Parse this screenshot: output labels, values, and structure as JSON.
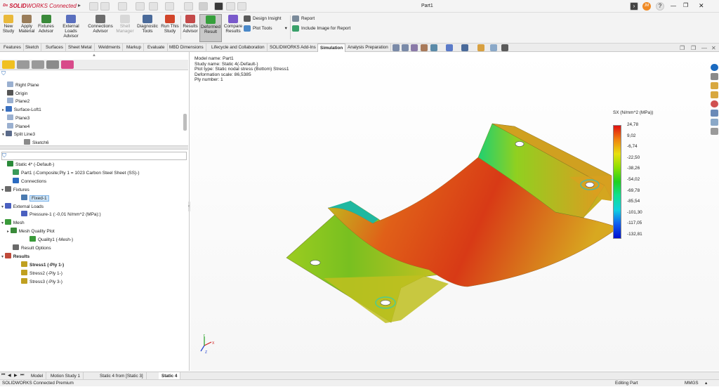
{
  "app": {
    "brand_solid": "SOLID",
    "brand_works": "WORKS",
    "brand_connected": " Connected",
    "doc_title": "Part1"
  },
  "ribbon": {
    "new_study": "New\nStudy",
    "apply_material": "Apply\nMaterial",
    "fixtures_advisor": "Fixtures\nAdvisor",
    "external_loads_advisor": "External Loads\nAdvisor",
    "connections_advisor": "Connections\nAdvisor",
    "shell_manager": "Shell\nManager",
    "diagnostic_tools": "Diagnostic\nTools",
    "run_this_study": "Run This\nStudy",
    "results_advisor": "Results\nAdvisor",
    "deformed_result": "Deformed\nResult",
    "compare_results": "Compare\nResults",
    "design_insight": "Design Insight",
    "plot_tools": "Plot Tools",
    "report": "Report",
    "include_image": "Include Image for Report"
  },
  "tabs": [
    "Features",
    "Sketch",
    "Surfaces",
    "Sheet Metal",
    "Weldments",
    "Markup",
    "Evaluate",
    "MBD Dimensions",
    "Lifecycle and Collaboration",
    "SOLIDWORKS Add-Ins",
    "Simulation",
    "Analysis Preparation"
  ],
  "active_tab": "Simulation",
  "feature_tree": [
    "Right Plane",
    "Origin",
    "Plane2",
    "Surface-Loft1",
    "Plane3",
    "Plane4",
    "Split Line3",
    "Sketch6"
  ],
  "sim_tree": {
    "study": "Static 4* (-Default-)",
    "part": "Part1 (-Composite;Ply 1 = 1023 Carbon Steel Sheet (SS)-)",
    "connections": "Connections",
    "fixtures": "Fixtures",
    "fixed": "Fixed-1",
    "external_loads": "External Loads",
    "pressure": "Pressure-1 (:-0,01 N/mm^2 (MPa):)",
    "mesh": "Mesh",
    "mesh_quality": "Mesh Quality Plot",
    "quality1": "Quality1 (-Mesh-)",
    "result_options": "Result Options",
    "results": "Results",
    "stress1": "Stress1 (-Ply 1-)",
    "stress2": "Stress2 (-Ply 1-)",
    "stress3": "Stress3 (-Ply 3-)"
  },
  "plot_info": {
    "model_name": "Model name: Part1",
    "study_name": "Study name: Static 4(-Default-)",
    "plot_type": "Plot type: Static nodal stress (Bottom) Stress1",
    "deformation_scale": "Deformation scale: 86,5385",
    "ply_number": "Ply number: 1"
  },
  "legend": {
    "title": "SX (N/mm^2 (MPa))",
    "values": [
      "24,78",
      "9,02",
      "-6,74",
      "-22,50",
      "-38,26",
      "-54,02",
      "-69,78",
      "-85,54",
      "-101,30",
      "-117,05",
      "-132,81"
    ]
  },
  "triad": {
    "x": "X",
    "y": "Y",
    "z": "Z"
  },
  "bottom_tabs": [
    "Model",
    "Motion Study 1",
    "Static 4 from [Static 3]",
    "Static 4"
  ],
  "status": {
    "left": "SOLIDWORKS Connected Premium",
    "mid": "Editing Part",
    "units": "MMGS"
  },
  "colors": {
    "accent": "#c8102e",
    "active_bg": "#c8c8c8",
    "selection": "#cde4f7"
  }
}
